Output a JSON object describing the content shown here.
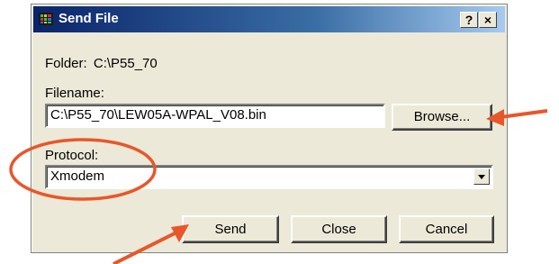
{
  "window": {
    "title": "Send File",
    "help_button": "?",
    "close_button": "×"
  },
  "folder": {
    "label": "Folder:",
    "value": "C:\\P55_70"
  },
  "filename": {
    "label": "Filename:",
    "value": "C:\\P55_70\\LEW05A-WPAL_V08.bin",
    "browse_label": "Browse..."
  },
  "protocol": {
    "label": "Protocol:",
    "selected": "Xmodem"
  },
  "actions": {
    "send_label": "Send",
    "close_label": "Close",
    "cancel_label": "Cancel"
  },
  "annotations": {
    "color": "#e8572a",
    "highlight": "protocol-field",
    "arrows": [
      "browse-button",
      "send-button"
    ]
  },
  "icons": [
    "app-icon",
    "help-icon",
    "close-icon",
    "dropdown-arrow-icon"
  ]
}
